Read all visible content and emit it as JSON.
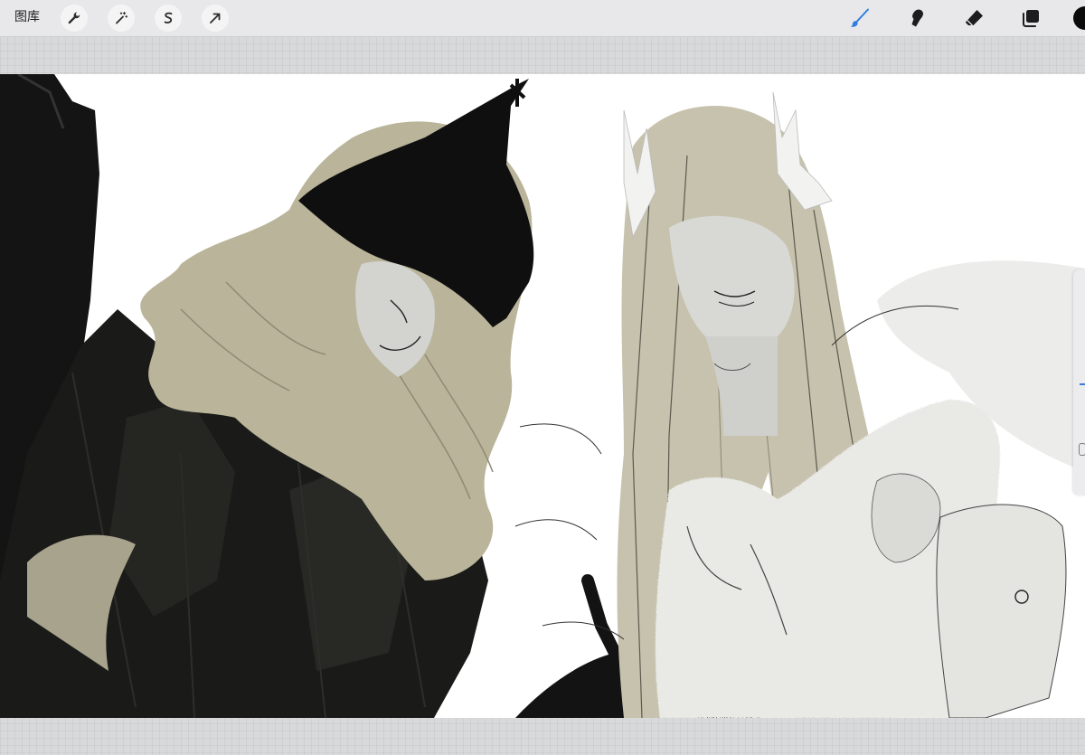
{
  "toolbar": {
    "gallery_label": "图库",
    "left_tools": [
      {
        "name": "actions",
        "icon": "wrench-icon"
      },
      {
        "name": "adjustments",
        "icon": "magic-wand-icon"
      },
      {
        "name": "selection",
        "icon": "selection-s-icon"
      },
      {
        "name": "transform",
        "icon": "arrow-cursor-icon"
      }
    ],
    "right_tools": [
      {
        "name": "brush",
        "icon": "brush-icon",
        "active": true
      },
      {
        "name": "smudge",
        "icon": "smudge-finger-icon",
        "active": false
      },
      {
        "name": "eraser",
        "icon": "eraser-icon",
        "active": false
      },
      {
        "name": "layers",
        "icon": "layers-icon",
        "active": false
      }
    ],
    "current_color": "#0b0b0b"
  },
  "colors": {
    "active_tool": "#2f7de1",
    "toolbar_bg": "#e8e8ea",
    "hair": "#b9b49a",
    "ink": "#111111",
    "light_grey": "#e6e6e3"
  },
  "canvas": {
    "artwork": "two-character-sketch"
  }
}
